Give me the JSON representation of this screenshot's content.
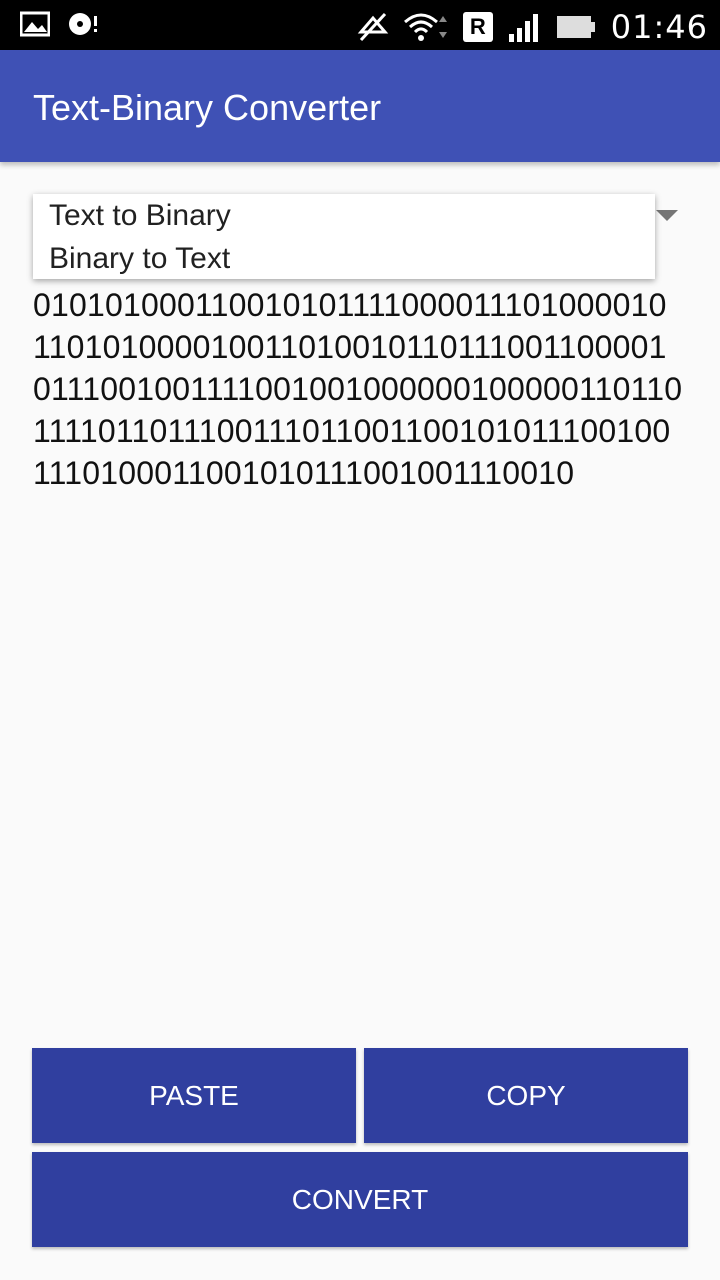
{
  "status_bar": {
    "time": "01:46",
    "left_icons": [
      "gallery-icon",
      "media-icon"
    ],
    "right_icons": [
      "mute-icon",
      "wifi-icon",
      "roaming-icon",
      "signal-icon",
      "battery-icon"
    ],
    "roaming_label": "R"
  },
  "app_bar": {
    "title": "Text-Binary Converter",
    "color": "#3f51b5"
  },
  "mode_dropdown": {
    "options": [
      "Text to Binary",
      "Binary to Text"
    ]
  },
  "output": {
    "binary_text": "010101000110010101111000011101000010110101000010011010010110111001100001011100100111100100100000010000011011011110110111001110110011001010111001001110100011001010111001001110010"
  },
  "buttons": {
    "paste": "PASTE",
    "copy": "COPY",
    "convert": "CONVERT",
    "color": "#303f9f"
  }
}
